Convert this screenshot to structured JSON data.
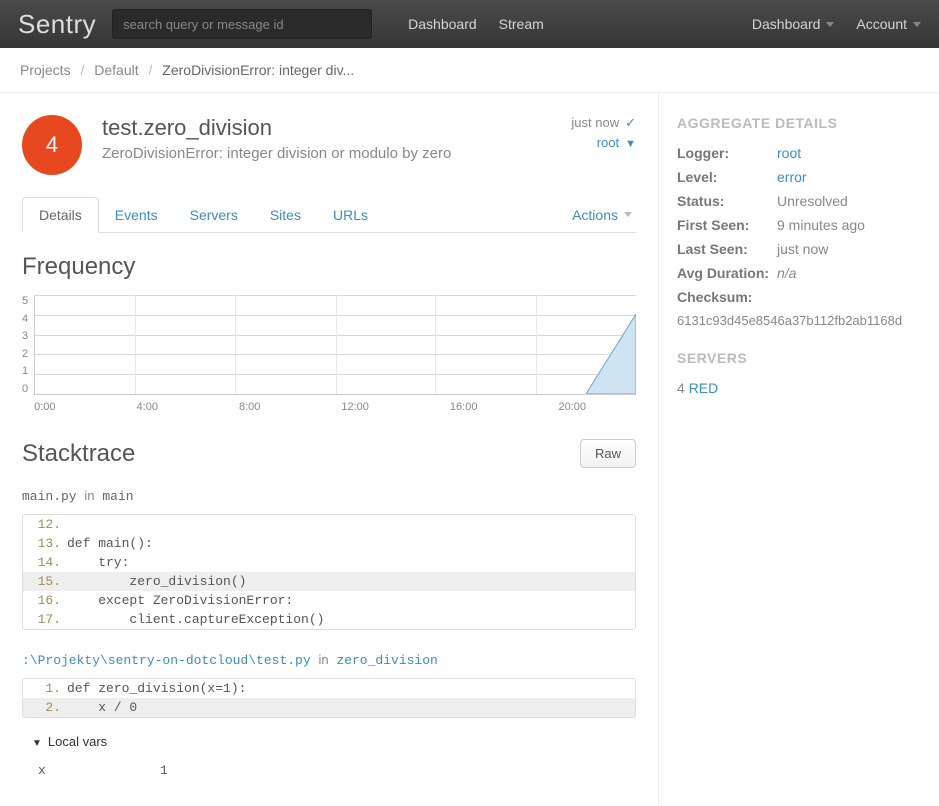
{
  "nav": {
    "brand": "Sentry",
    "search_placeholder": "search query or message id",
    "left": [
      "Dashboard",
      "Stream"
    ],
    "right": [
      "Dashboard",
      "Account"
    ]
  },
  "breadcrumb": {
    "items": [
      "Projects",
      "Default"
    ],
    "current": "ZeroDivisionError: integer div..."
  },
  "error": {
    "count": "4",
    "title": "test.zero_division",
    "subtitle": "ZeroDivisionError: integer division or modulo by zero",
    "last_seen_label": "just now",
    "user": "root"
  },
  "tabs": [
    "Details",
    "Events",
    "Servers",
    "Sites",
    "URLs"
  ],
  "actions_label": "Actions",
  "frequency": {
    "heading": "Frequency"
  },
  "chart_data": {
    "type": "area",
    "x": [
      "0:00",
      "4:00",
      "8:00",
      "12:00",
      "16:00",
      "20:00"
    ],
    "y_ticks": [
      0,
      1,
      2,
      3,
      4,
      5
    ],
    "values": [
      0,
      0,
      0,
      0,
      0,
      0,
      4
    ],
    "xlabel": "",
    "ylabel": "",
    "ylim": [
      0,
      5
    ]
  },
  "stacktrace": {
    "heading": "Stacktrace",
    "raw_button": "Raw",
    "frames": [
      {
        "file": "main.py",
        "func": "main",
        "lines": [
          {
            "n": "12.",
            "src": ""
          },
          {
            "n": "13.",
            "src": "def main():"
          },
          {
            "n": "14.",
            "src": "    try:"
          },
          {
            "n": "15.",
            "src": "        zero_division()",
            "hl": true
          },
          {
            "n": "16.",
            "src": "    except ZeroDivisionError:"
          },
          {
            "n": "17.",
            "src": "        client.captureException()"
          }
        ]
      },
      {
        "file": ":\\Projekty\\sentry-on-dotcloud\\test.py",
        "func": "zero_division",
        "path_style": true,
        "lines": [
          {
            "n": "1.",
            "src": "def zero_division(x=1):"
          },
          {
            "n": "2.",
            "src": "    x / 0",
            "hl": true
          }
        ],
        "local_vars": {
          "label": "Local vars",
          "rows": [
            {
              "k": "x",
              "v": "1"
            }
          ]
        }
      }
    ]
  },
  "aggregate": {
    "heading": "Aggregate Details",
    "rows": [
      {
        "k": "Logger:",
        "v": "root",
        "link": true
      },
      {
        "k": "Level:",
        "v": "error",
        "link": true
      },
      {
        "k": "Status:",
        "v": "Unresolved"
      },
      {
        "k": "First Seen:",
        "v": "9 minutes ago"
      },
      {
        "k": "Last Seen:",
        "v": "just now"
      },
      {
        "k": "Avg Duration:",
        "v": "n/a",
        "italic": true
      },
      {
        "k": "Checksum:",
        "v": ""
      }
    ],
    "checksum": "6131c93d45e8546a37b112fb2ab1168d"
  },
  "servers": {
    "heading": "Servers",
    "count": "4",
    "name": "RED"
  }
}
